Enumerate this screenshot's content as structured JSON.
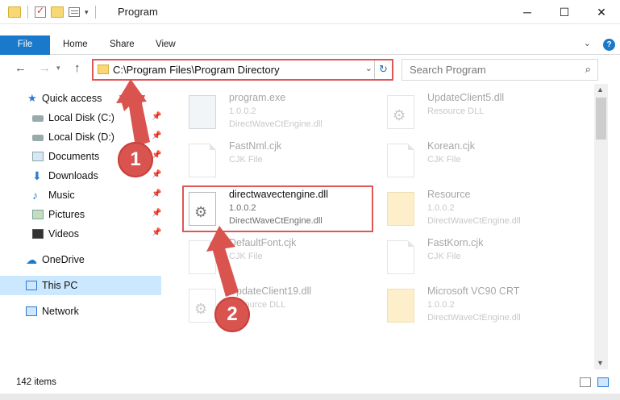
{
  "window": {
    "title": "Program",
    "minimize": "─",
    "maximize": "☐",
    "close": "✕"
  },
  "ribbon": {
    "tabs": [
      "File",
      "Home",
      "Share",
      "View"
    ],
    "collapse_icon": "chevron-down-icon",
    "help_label": "?"
  },
  "address": {
    "path": "C:\\Program Files\\Program Directory",
    "dropdown": "⌄",
    "refresh": "↻"
  },
  "search": {
    "placeholder": "Search Program"
  },
  "nav": {
    "items": [
      {
        "label": "Quick access",
        "icon": "star-icon",
        "pinned": false
      },
      {
        "label": "Local Disk (C:)",
        "icon": "drive-icon",
        "pinned": true
      },
      {
        "label": "Local Disk (D:)",
        "icon": "drive-icon",
        "pinned": true
      },
      {
        "label": "Documents",
        "icon": "documents-icon",
        "pinned": true
      },
      {
        "label": "Downloads",
        "icon": "download-icon",
        "pinned": true
      },
      {
        "label": "Music",
        "icon": "music-icon",
        "pinned": true
      },
      {
        "label": "Pictures",
        "icon": "pictures-icon",
        "pinned": true
      },
      {
        "label": "Videos",
        "icon": "videos-icon",
        "pinned": true
      },
      {
        "label": "OneDrive",
        "icon": "cloud-icon",
        "pinned": false
      },
      {
        "label": "This PC",
        "icon": "computer-icon",
        "pinned": false,
        "selected": true
      },
      {
        "label": "Network",
        "icon": "network-icon",
        "pinned": false
      }
    ]
  },
  "files": [
    {
      "name": "program.exe",
      "line2": "1.0.0.2",
      "line3": "DirectWaveCtEngine.dll",
      "icon": "exe-icon",
      "faded": true
    },
    {
      "name": "UpdateClient5.dll",
      "line2": "Resource DLL",
      "line3": "",
      "icon": "gear-file-icon",
      "faded": true
    },
    {
      "name": "FastNml.cjk",
      "line2": "CJK File",
      "line3": "",
      "icon": "file-icon",
      "faded": true
    },
    {
      "name": "Korean.cjk",
      "line2": "CJK File",
      "line3": "",
      "icon": "file-icon",
      "faded": true
    },
    {
      "name": "directwavectengine.dll",
      "line2": "1.0.0.2",
      "line3": "DirectWaveCtEngine.dll",
      "icon": "gear-file-icon",
      "faded": false,
      "highlighted": true
    },
    {
      "name": "Resource",
      "line2": "1.0.0.2",
      "line3": "DirectWaveCtEngine.dll",
      "icon": "folder-icon",
      "faded": true
    },
    {
      "name": "DefaultFont.cjk",
      "line2": "CJK File",
      "line3": "",
      "icon": "file-icon",
      "faded": true
    },
    {
      "name": "FastKorn.cjk",
      "line2": "CJK File",
      "line3": "",
      "icon": "file-icon",
      "faded": true
    },
    {
      "name": "UpdateClient19.dll",
      "line2": "Resource DLL",
      "line3": "",
      "icon": "gear-file-icon",
      "faded": true
    },
    {
      "name": "Microsoft VC90 CRT",
      "line2": "1.0.0.2",
      "line3": "DirectWaveCtEngine.dll",
      "icon": "folder-icon",
      "faded": true
    }
  ],
  "status": {
    "item_count": "142 items"
  },
  "annotations": {
    "badge1": "1",
    "badge2": "2",
    "color": "#d9534f"
  }
}
